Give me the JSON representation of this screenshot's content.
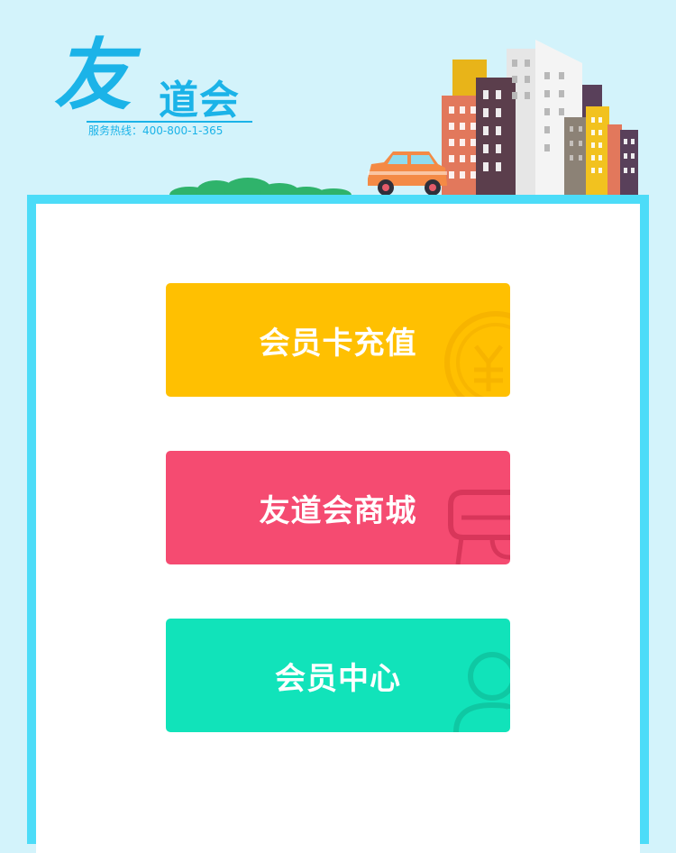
{
  "logo": {
    "char_big": "友",
    "char_rest": "道会",
    "hotline": "服务热线：400-800-1-365"
  },
  "menu": {
    "recharge_label": "会员卡充值",
    "mall_label": "友道会商城",
    "member_label": "会员中心"
  },
  "colors": {
    "background": "#d3f3fb",
    "frame": "#4cdcf8",
    "brand": "#1bb3e8",
    "recharge": "#ffc001",
    "mall": "#f54b71",
    "member": "#11e3ba"
  },
  "icons": {
    "recharge": "yen-coin-icon",
    "mall": "shopping-bag-icon",
    "member": "user-icon"
  }
}
